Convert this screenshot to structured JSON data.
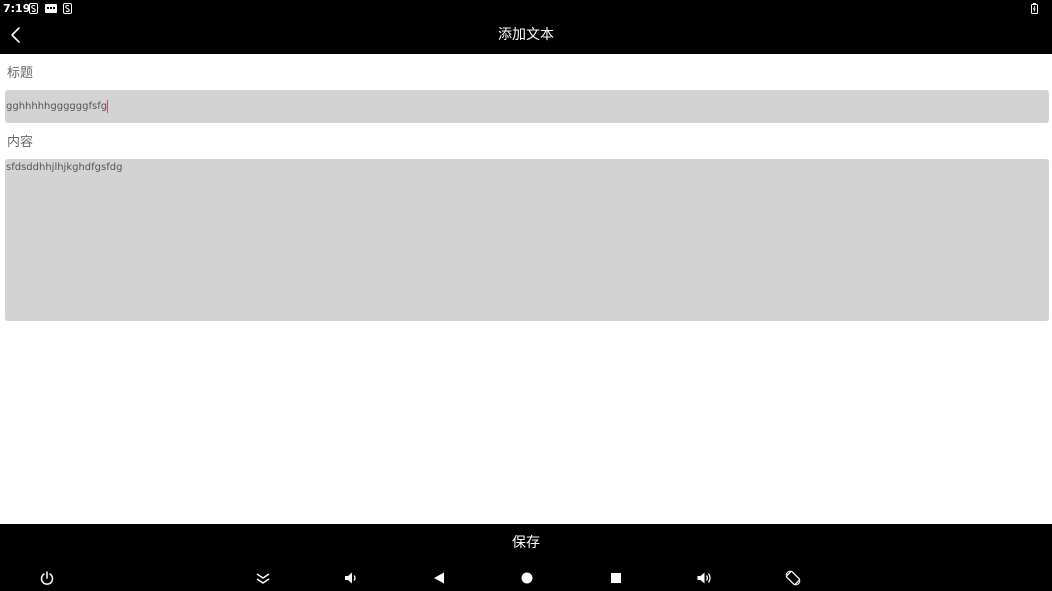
{
  "status_bar": {
    "time": "7:19"
  },
  "header": {
    "title": "添加文本",
    "back_icon": "chevron-left-icon"
  },
  "form": {
    "title_label": "标题",
    "title_value": "gghhhhhggggggfsfg",
    "content_label": "内容",
    "content_value": "sfdsddhhjlhjkghdfgsfdg"
  },
  "footer": {
    "save_label": "保存"
  },
  "nav_bar": {
    "icons": [
      "power-icon",
      "collapse-icon",
      "volume-down-icon",
      "back-triangle-icon",
      "home-circle-icon",
      "recents-square-icon",
      "volume-up-icon",
      "rotate-icon"
    ]
  },
  "colors": {
    "bar_background": "#000000",
    "field_background": "#d3d3d3",
    "caret": "#e0407a"
  }
}
